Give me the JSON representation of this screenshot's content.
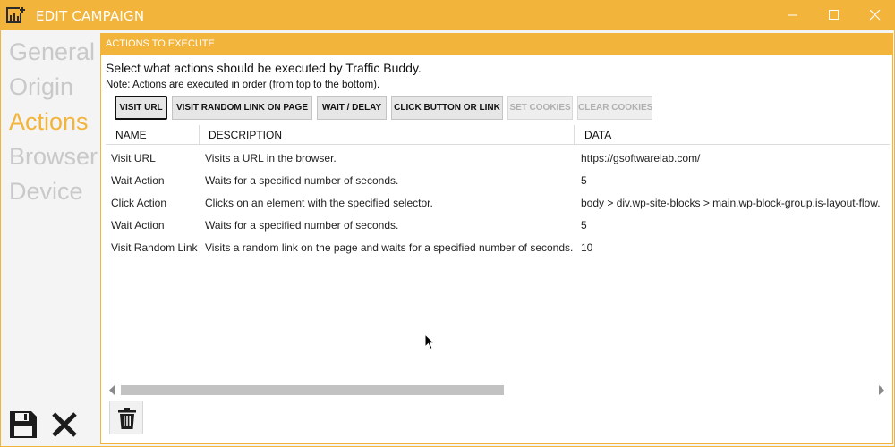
{
  "window": {
    "title": "EDIT CAMPAIGN"
  },
  "nav": {
    "items": [
      {
        "label": "General",
        "active": false
      },
      {
        "label": "Origin",
        "active": false
      },
      {
        "label": "Actions",
        "active": true
      },
      {
        "label": "Browser",
        "active": false
      },
      {
        "label": "Device",
        "active": false
      }
    ]
  },
  "panel": {
    "header": "ACTIONS TO EXECUTE",
    "intro": "Select what actions should be executed by Traffic Buddy.",
    "note": "Note: Actions are executed in order (from top to the bottom)."
  },
  "toolbar": {
    "visit_url": "VISIT URL",
    "visit_random_link": "VISIT RANDOM LINK ON PAGE",
    "wait_delay": "WAIT / DELAY",
    "click_button": "CLICK BUTTON OR LINK",
    "set_cookies": "SET COOKIES",
    "clear_cookies": "CLEAR COOKIES"
  },
  "table": {
    "columns": [
      "NAME",
      "DESCRIPTION",
      "DATA"
    ],
    "rows": [
      {
        "name": "Visit URL",
        "description": "Visits a URL in the browser.",
        "data": "https://gsoftwarelab.com/"
      },
      {
        "name": "Wait Action",
        "description": "Waits for a specified number of seconds.",
        "data": "5"
      },
      {
        "name": "Click Action",
        "description": "Clicks on an element with the specified selector.",
        "data": "body > div.wp-site-blocks > main.wp-block-group.is-layout-flow."
      },
      {
        "name": "Wait Action",
        "description": "Waits for a specified number of seconds.",
        "data": "5"
      },
      {
        "name": "Visit Random Link",
        "description": "Visits a random link on the page and waits for a specified number of seconds.",
        "data": "10"
      }
    ]
  },
  "colors": {
    "accent": "#f2b43a",
    "nav_inactive": "#c9c9c9"
  },
  "icons": {
    "app": "chart-plus-icon",
    "save": "floppy-disk-icon",
    "close": "x-icon",
    "delete": "trash-icon"
  }
}
